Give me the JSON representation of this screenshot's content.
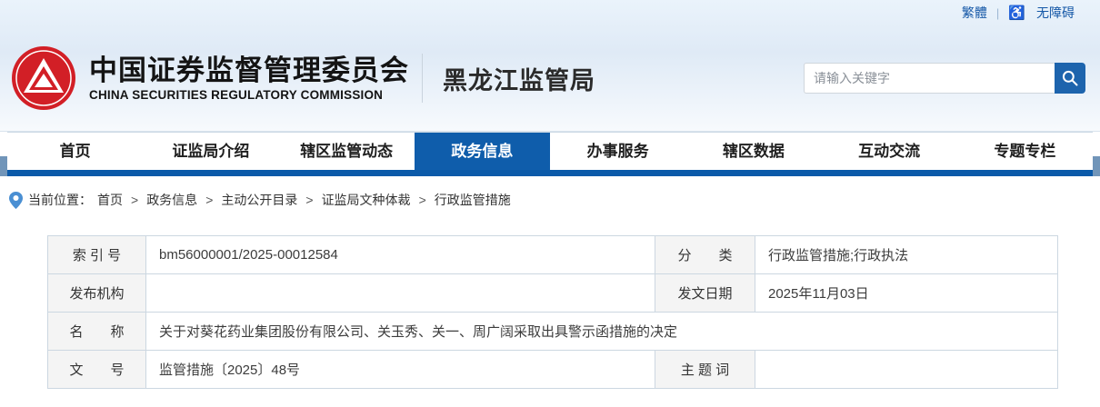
{
  "topbar": {
    "traditional_label": "繁體",
    "divider": "|",
    "accessibility_label": "无障碍"
  },
  "header": {
    "org_cn": "中国证券监督管理委员会",
    "org_en": "CHINA SECURITIES REGULATORY COMMISSION",
    "bureau": "黑龙江监管局",
    "search": {
      "placeholder": "请输入关键字"
    }
  },
  "nav": {
    "items": [
      {
        "label": "首页",
        "active": false
      },
      {
        "label": "证监局介绍",
        "active": false
      },
      {
        "label": "辖区监管动态",
        "active": false
      },
      {
        "label": "政务信息",
        "active": true
      },
      {
        "label": "办事服务",
        "active": false
      },
      {
        "label": "辖区数据",
        "active": false
      },
      {
        "label": "互动交流",
        "active": false
      },
      {
        "label": "专题专栏",
        "active": false
      }
    ]
  },
  "breadcrumb": {
    "prefix": "当前位置：",
    "separator": ">",
    "items": [
      "首页",
      "政务信息",
      "主动公开目录",
      "证监局文种体裁",
      "行政监管措施"
    ]
  },
  "doc_table": {
    "rows": [
      {
        "cells": [
          {
            "label": "索 引 号",
            "value": "bm56000001/2025-00012584"
          },
          {
            "label": "分　　类",
            "value": "行政监管措施;行政执法"
          }
        ]
      },
      {
        "cells": [
          {
            "label": "发布机构",
            "value": ""
          },
          {
            "label": "发文日期",
            "value": "2025年11月03日"
          }
        ]
      },
      {
        "cells": [
          {
            "label": "名　　称",
            "value": "关于对葵花药业集团股份有限公司、关玉秀、关一、周广阔采取出具警示函措施的决定"
          }
        ]
      },
      {
        "cells": [
          {
            "label": "文　　号",
            "value": "监管措施〔2025〕48号"
          },
          {
            "label": "主 题 词",
            "value": ""
          }
        ]
      }
    ]
  },
  "colors": {
    "accent_blue": "#0f5dab",
    "nav_border_blue": "#0b5aa9",
    "link_blue": "#1558a7",
    "search_btn_blue": "#1d64ad",
    "emblem_red": "#d21f26",
    "header_bg": "#e5eff9",
    "label_cell_bg": "#f4f4f4",
    "table_border": "#ccd7e1"
  }
}
